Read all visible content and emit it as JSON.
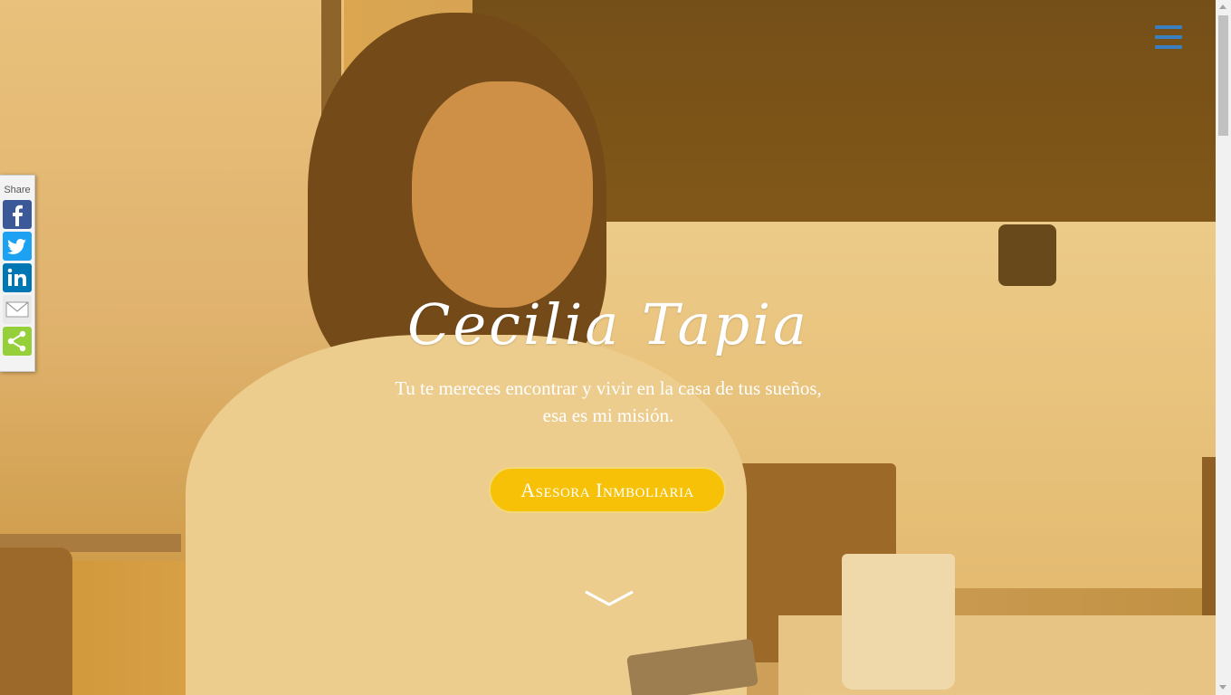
{
  "hero": {
    "title": "Cecilia Tapia",
    "subtitle_line1": "Tu te mereces encontrar y vivir en la casa de tus sueños,",
    "subtitle_line2": "esa es mi misión.",
    "cta_label": "Asesora Inmboliaria"
  },
  "share": {
    "label": "Share",
    "buttons": [
      {
        "icon": "facebook-icon",
        "color": "#3b5998"
      },
      {
        "icon": "twitter-icon",
        "color": "#1da1f2"
      },
      {
        "icon": "linkedin-icon",
        "color": "#0077b5"
      },
      {
        "icon": "email-icon",
        "color": "#e9e9e9"
      },
      {
        "icon": "share-icon",
        "color": "#95d03a"
      }
    ]
  },
  "colors": {
    "accent": "#f7c107",
    "menu": "#3a7fc0",
    "overlay": "#d9a451"
  }
}
